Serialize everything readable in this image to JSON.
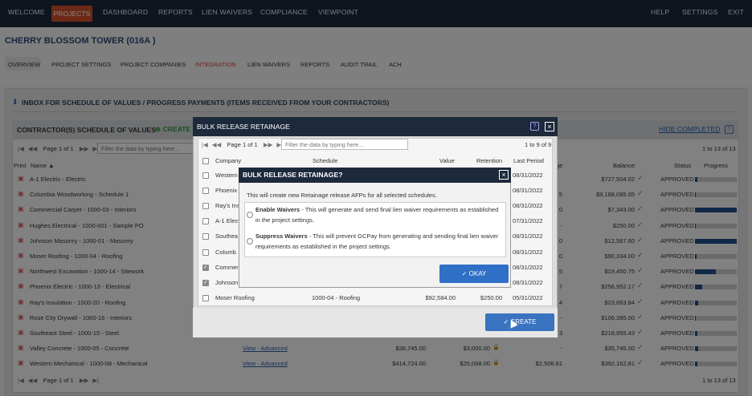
{
  "nav": {
    "welcome": "WELCOME",
    "projects": "PROJECTS",
    "dashboard": "DASHBOARD",
    "reports": "REPORTS",
    "lien_waivers": "LIEN WAIVERS",
    "compliance": "COMPLIANCE",
    "viewpoint": "VIEWPOINT",
    "help": "HELP",
    "settings": "SETTINGS",
    "exit": "EXIT"
  },
  "project_title": "CHERRY BLOSSOM TOWER (016A )",
  "subtabs": {
    "overview": "OVERVIEW",
    "project_settings": "PROJECT SETTINGS",
    "project_companies": "PROJECT COMPANIES",
    "integration": "INTEGRATION",
    "lien_waivers": "LIEN WAIVERS",
    "reports": "REPORTS",
    "audit_trail": "AUDIT TRAIL",
    "ach": "ACH"
  },
  "inbox_title": "INBOX FOR SCHEDULE OF VALUES / PROGRESS PAYMENTS (ITEMS RECEIVED FROM YOUR CONTRACTORS)",
  "sov": {
    "title": "CONTRACTOR(S) SCHEDULE OF VALUES",
    "create": "CREATE",
    "hide_completed": "HIDE COMPLETED",
    "page_text": "Page 1 of 1",
    "filter_placeholder": "Filter the data by typing here...",
    "count": "1 to 13 of 13",
    "columns": {
      "print": "Print",
      "name": "Name",
      "ge": "ge",
      "balance": "Balance",
      "status": "Status",
      "progress": "Progress"
    },
    "rows": [
      {
        "name": "A-1 Electric - Electric",
        "mid": "",
        "balance": "$727,504.02",
        "status": "APPROVED",
        "progress": 0.05
      },
      {
        "name": "Columbia Woodworking - Schedule 1",
        "mid": "5",
        "balance": "$9,188,085.05",
        "status": "APPROVED",
        "progress": 0.02
      },
      {
        "name": "Commercial Carpet - 1000-03 - Interiors",
        "mid": "0",
        "balance": "$7,343.00",
        "status": "APPROVED",
        "progress": 1.0
      },
      {
        "name": "Hughes Electrical - 1000-001 - Sample PO",
        "mid": "-",
        "balance": "$250.00",
        "status": "APPROVED",
        "progress": 0.02
      },
      {
        "name": "Johnson Masonry - 1000-01 - Masonry",
        "mid": "0",
        "balance": "$12,567.60",
        "status": "APPROVED",
        "progress": 1.0
      },
      {
        "name": "Moser Roofing - 1000-04 - Roofing",
        "mid": "0",
        "balance": "$90,334.00",
        "status": "APPROVED",
        "progress": 0.03
      },
      {
        "name": "Northwest Excavation - 1000-14 - Sitework",
        "mid": "5",
        "balance": "$19,450.75",
        "status": "APPROVED",
        "progress": 0.5
      },
      {
        "name": "Phoenix Electric - 1000-13 - Electrical",
        "mid": "7",
        "balance": "$256,952.17",
        "status": "APPROVED",
        "progress": 0.17
      },
      {
        "name": "Ray's Insulation - 1000-20 - Roofing",
        "mid": "4",
        "balance": "$23,863.84",
        "status": "APPROVED",
        "progress": 0.07
      },
      {
        "name": "Rose City Drywall - 1000-16 - Interiors",
        "mid": "-",
        "balance": "$106,395.00",
        "status": "APPROVED",
        "progress": 0.02
      },
      {
        "name": "Southeast Steel - 1000-15 - Steel",
        "mid": "3",
        "balance": "$218,955.43",
        "status": "APPROVED",
        "progress": 0.05
      },
      {
        "name": "Valley Concrete - 1000-05 - Concrete",
        "view": "View",
        "sep": "-",
        "advanced": "Advanced",
        "v1": "$38,745.00",
        "v2": "$3,000.00",
        "v3": "-",
        "balance": "$35,745.00",
        "status": "APPROVED",
        "progress": 0.07
      },
      {
        "name": "Western Mechanical - 1000-08 - Mechanical",
        "view": "View",
        "sep": "-",
        "advanced": "Advanced",
        "v1": "$414,724.00",
        "v2": "$25,068.00",
        "v3": "$2,506.81",
        "balance": "$392,162.81",
        "status": "APPROVED",
        "progress": 0.05
      }
    ]
  },
  "bulk": {
    "title": "BULK RELEASE RETAINAGE",
    "page_text": "Page 1 of 1",
    "filter_placeholder": "Filter the data by typing here...",
    "count": "1 to 9 of 9",
    "columns": {
      "company": "Company",
      "schedule": "Schedule",
      "value": "Value",
      "retention": "Retention",
      "last_period": "Last Period"
    },
    "rows": [
      {
        "company": "Western",
        "date": "08/31/2022",
        "checked": false
      },
      {
        "company": "Phoenix",
        "date": "08/31/2022",
        "checked": false
      },
      {
        "company": "Ray's Ins",
        "date": "08/31/2022",
        "checked": false
      },
      {
        "company": "A-1 Elect",
        "date": "07/31/2022",
        "checked": false
      },
      {
        "company": "Southea",
        "date": "08/31/2022",
        "checked": false
      },
      {
        "company": "Columb",
        "date": "08/31/2022",
        "checked": false
      },
      {
        "company": "Commer",
        "date": "08/31/2022",
        "checked": true
      },
      {
        "company": "Johnson",
        "date": "08/31/2022",
        "checked": true
      },
      {
        "company": "Moser Roofing",
        "schedule": "1000-04 - Roofing",
        "value": "$92,584.00",
        "retention": "$250.00",
        "date": "05/31/2022",
        "checked": false
      }
    ],
    "create_label": "CREATE"
  },
  "confirm": {
    "title": "BULK RELEASE RETAINAGE?",
    "description": "This will create new Retainage release AFPs for all selected schedules.",
    "enable_title": "Enable Waivers",
    "enable_text": " - This will generate and send final lien waiver requirements as established in the project settings.",
    "suppress_title": "Suppress Waivers",
    "suppress_text": " - This will prevent GCPay from generating and sending final lien waiver requirements as established in the project settings.",
    "okay_label": "OKAY"
  },
  "colors": {
    "nav_bg": "#1d2a3c",
    "accent": "#d2502f",
    "primary_button": "#2f6fc6",
    "approved_check": "#3aa53a",
    "progress_fill": "#1f4f86"
  }
}
